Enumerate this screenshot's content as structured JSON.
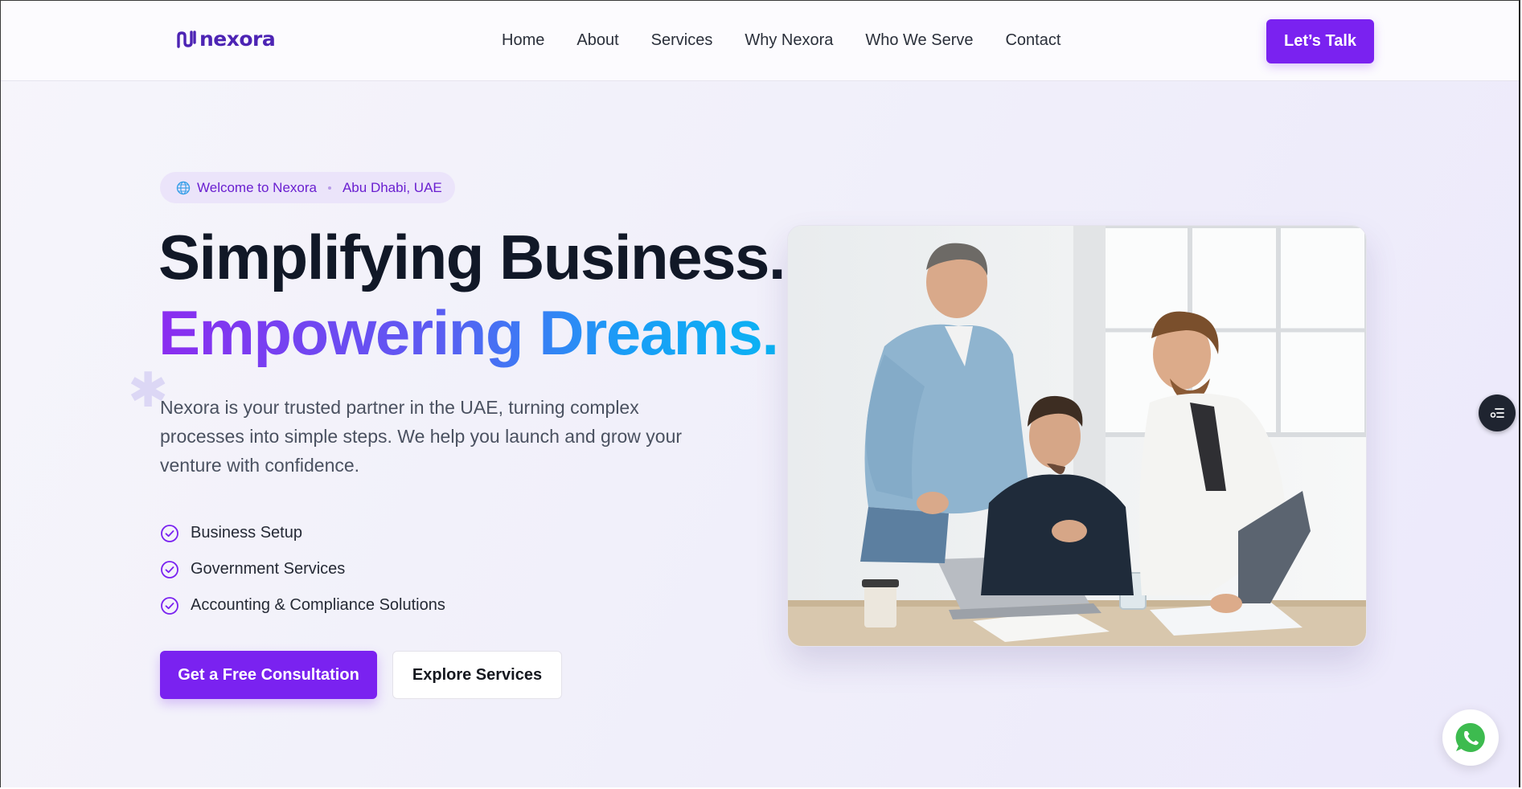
{
  "brand": {
    "name": "nexora",
    "color": "#4d24b4"
  },
  "nav": {
    "items": [
      "Home",
      "About",
      "Services",
      "Why Nexora",
      "Who We Serve",
      "Contact"
    ],
    "cta_label": "Let’s Talk"
  },
  "hero": {
    "badge": {
      "icon": "globe-icon",
      "welcome": "Welcome to Nexora",
      "location": "Abu Dhabi, UAE"
    },
    "title_line1": "Simplifying Business.",
    "title_line2": "Empowering Dreams.",
    "description": "Nexora is your trusted partner in the UAE, turning complex processes into simple steps. We help you launch and grow your venture with confidence.",
    "features": [
      "Business Setup",
      "Government Services",
      "Accounting & Compliance Solutions"
    ],
    "primary_cta": "Get a Free Consultation",
    "secondary_cta": "Explore Services"
  },
  "colors": {
    "accent": "#7a22f0",
    "gradient_start": "#8b2cf0",
    "gradient_end": "#0bb3f3",
    "heading": "#111827"
  },
  "floating": {
    "menu_icon": "list-settings-icon",
    "chat_icon": "whatsapp-icon"
  }
}
